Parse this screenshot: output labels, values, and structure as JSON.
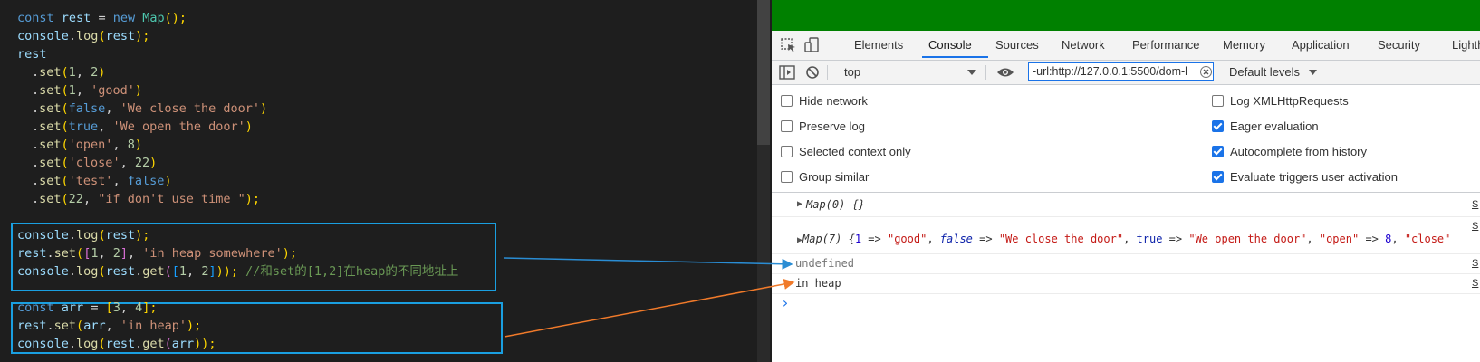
{
  "editor": {
    "lines": [
      [
        "const",
        "rest",
        "=",
        "new",
        "Map",
        "();"
      ],
      [
        "console",
        ".",
        "log",
        "(",
        "rest",
        ");"
      ],
      [
        "rest"
      ],
      [
        ".",
        "set",
        "(",
        "1",
        ", ",
        "2",
        ")"
      ],
      [
        ".",
        "set",
        "(",
        "1",
        ", ",
        "'good'",
        ")"
      ],
      [
        ".",
        "set",
        "(",
        "false",
        ", ",
        "'We close the door'",
        ")"
      ],
      [
        ".",
        "set",
        "(",
        "true",
        ", ",
        "'We open the door'",
        ")"
      ],
      [
        ".",
        "set",
        "(",
        "'open'",
        ", ",
        "8",
        ")"
      ],
      [
        ".",
        "set",
        "(",
        "'close'",
        ", ",
        "22",
        ")"
      ],
      [
        ".",
        "set",
        "(",
        "'test'",
        ", ",
        "false",
        ")"
      ],
      [
        ".",
        "set",
        "(",
        "22",
        ", ",
        "\"if don't use time \"",
        ");"
      ],
      [
        "console",
        ".",
        "log",
        "(",
        "rest",
        ");"
      ],
      [
        "rest",
        ".",
        "set",
        "(",
        "[",
        "1",
        ", ",
        "2",
        "]",
        ", ",
        "'in heap somewhere'",
        ");"
      ],
      [
        "console",
        ".",
        "log",
        "(",
        "rest",
        ".",
        "get",
        "(",
        "[",
        "1",
        ", ",
        "2",
        "]",
        "));",
        " ",
        "//和set的[1,2]在heap的不同地址上"
      ],
      [
        "const",
        "arr",
        "=",
        "[",
        "3",
        ", ",
        "4",
        "];"
      ],
      [
        "rest",
        ".",
        "set",
        "(",
        "arr",
        ", ",
        "'in heap'",
        ");"
      ],
      [
        "console",
        ".",
        "log",
        "(",
        "rest",
        ".",
        "get",
        "(",
        "arr",
        "));"
      ]
    ]
  },
  "devtools": {
    "tabs": [
      "Elements",
      "Console",
      "Sources",
      "Network",
      "Performance",
      "Memory",
      "Application",
      "Security",
      "Lighthouse"
    ],
    "active_tab": "Console",
    "context": "top",
    "filter_value": "-url:http://127.0.0.1:5500/dom-l",
    "levels": "Default levels",
    "settings_left": [
      {
        "label": "Hide network",
        "checked": false
      },
      {
        "label": "Preserve log",
        "checked": false
      },
      {
        "label": "Selected context only",
        "checked": false
      },
      {
        "label": "Group similar",
        "checked": false
      }
    ],
    "settings_right": [
      {
        "label": "Log XMLHttpRequests",
        "checked": false
      },
      {
        "label": "Eager evaluation",
        "checked": true
      },
      {
        "label": "Autocomplete from history",
        "checked": true
      },
      {
        "label": "Evaluate triggers user activation",
        "checked": true
      }
    ],
    "console": {
      "row1_text": "Map(0) {}",
      "row2": {
        "head": "Map(7) {",
        "parts": [
          "1",
          " => ",
          "\"good\"",
          ", ",
          "false",
          " => ",
          "\"We close the door\"",
          ", ",
          "true",
          " => ",
          "\"We open the door\"",
          ", ",
          "\"open\"",
          " => ",
          "8",
          ", ",
          "\"close\""
        ]
      },
      "row3_text": "undefined",
      "row4_text": "in heap",
      "source_label": "S",
      "prompt": "›"
    }
  },
  "colors": {
    "accent": "#1a73e8",
    "box_border": "#1a9fe0",
    "green_bar": "#008000",
    "arrow_blue": "#2a8dd4",
    "arrow_orange": "#f07a2a"
  }
}
